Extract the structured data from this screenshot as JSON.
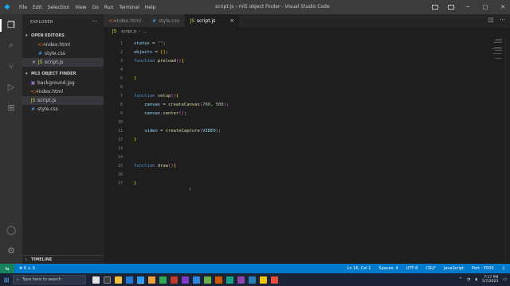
{
  "window": {
    "title": "script.js - ml5 object Finder - Visual Studio Code",
    "menus": [
      "File",
      "Edit",
      "Selection",
      "View",
      "Go",
      "Run",
      "Terminal",
      "Help"
    ]
  },
  "explorer": {
    "title": "EXPLORER",
    "open_editors_label": "OPEN EDITORS",
    "open_editors": [
      {
        "name": "index.html",
        "type": "html"
      },
      {
        "name": "style.css",
        "type": "css"
      },
      {
        "name": "script.js",
        "type": "js"
      }
    ],
    "folder_label": "ML5 OBJECT FINDER",
    "files": [
      {
        "name": "background.jpg",
        "type": "img"
      },
      {
        "name": "index.html",
        "type": "html"
      },
      {
        "name": "script.js",
        "type": "js"
      },
      {
        "name": "style.css",
        "type": "css"
      }
    ],
    "timeline_label": "TIMELINE"
  },
  "tabs": [
    {
      "label": "index.html",
      "type": "html"
    },
    {
      "label": "style.css",
      "type": "css"
    },
    {
      "label": "script.js",
      "type": "js"
    }
  ],
  "breadcrumb": {
    "file": "script.js"
  },
  "editor": {
    "line_numbers": [
      "1",
      "2",
      "3",
      "4",
      "5",
      "6",
      "7",
      "8",
      "9",
      "10",
      "11",
      "12",
      "13",
      "14",
      "15",
      "16",
      "17"
    ],
    "code": {
      "l1_var": "status",
      "l1_op": " = ",
      "l1_str": "\"\"",
      "l1_end": ";",
      "l2_var": "objects",
      "l2_op": " = ",
      "l2_val": "[]",
      "l2_end": ";",
      "l3_kw": "function",
      "l3_fn": "preload",
      "l3_paren": "()",
      "l3_brace": "{",
      "l5_brace": "}",
      "l7_kw": "function",
      "l7_fn": "setup",
      "l7_paren": "()",
      "l7_brace": "{",
      "l8_var": "canvas",
      "l8_op": " = ",
      "l8_fn": "createCanvas",
      "l8_open": "(",
      "l8_n1": "700",
      "l8_sep": ", ",
      "l8_n2": "500",
      "l8_close": ")",
      "l8_end": ";",
      "l9_var": "canvas",
      "l9_dot": ".",
      "l9_fn": "center",
      "l9_paren": "()",
      "l9_end": ";",
      "l11_var": "video",
      "l11_op": " = ",
      "l11_fn": "createCapture",
      "l11_open": "(",
      "l11_arg": "VIDEO",
      "l11_close": ")",
      "l11_end": ";",
      "l12_brace": "}",
      "l15_kw": "function",
      "l15_fn": "draw",
      "l15_paren": "()",
      "l15_brace": "{",
      "l17_brace": "}"
    }
  },
  "statusbar": {
    "left": [
      "⊗ 0  ⚠ 0"
    ],
    "right": [
      "Ln 16, Col 1",
      "Spaces: 4",
      "UTF-8",
      "CRLF",
      "JavaScript",
      "Port : 5500"
    ]
  },
  "taskbar": {
    "search_placeholder": "Type here to search",
    "clock_time": "7:17 PM",
    "clock_date": "5/7/2023"
  },
  "colors": {
    "accent": "#007acc",
    "activitybar": "#333333",
    "sidebar": "#252526",
    "editor": "#1e1e1e"
  }
}
